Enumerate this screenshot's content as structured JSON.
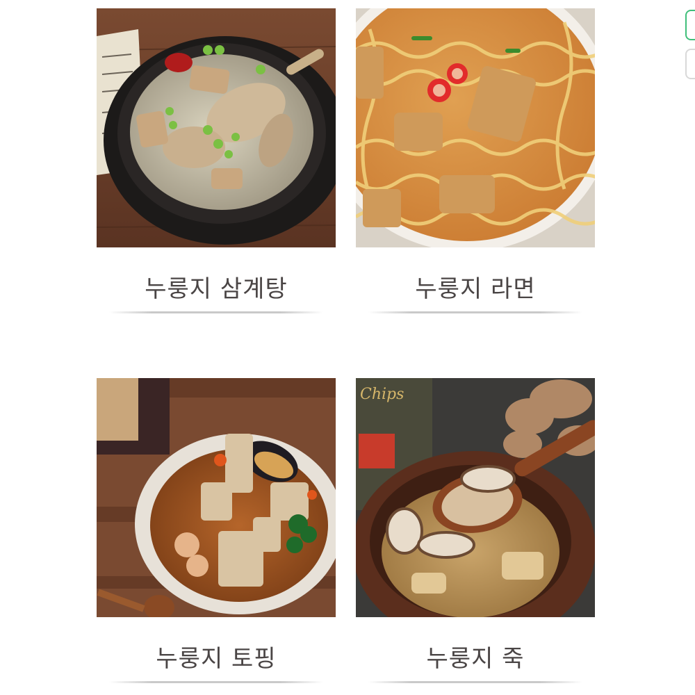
{
  "recipes": [
    {
      "title": "누룽지 삼계탕",
      "image": "samgyetang-photo"
    },
    {
      "title": "누룽지 라면",
      "image": "ramen-photo"
    },
    {
      "title": "누룽지 토핑",
      "image": "topping-photo"
    },
    {
      "title": "누룽지 죽",
      "image": "porridge-photo"
    }
  ],
  "porridge_photo_package_text": "Chips",
  "colors": {
    "caption": "#4a4545",
    "divider": "#c9c9c9",
    "side_button_active": "#3fbf7a",
    "side_button_inactive": "#d8d8d8"
  }
}
